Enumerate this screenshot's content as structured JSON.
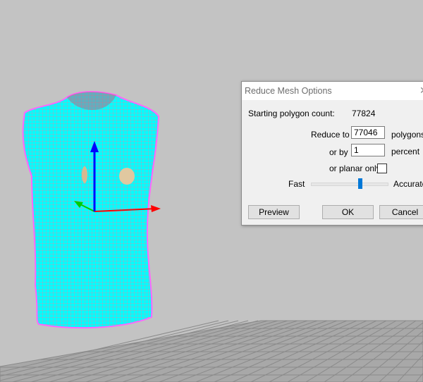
{
  "dialog": {
    "title": "Reduce Mesh Options",
    "close_icon": "close-icon",
    "starting_label": "Starting polygon count:",
    "starting_value": "77824",
    "reduce_to_label": "Reduce to",
    "reduce_to_value": "77046",
    "polygons_label": "polygons",
    "or_by_label": "or by",
    "or_by_value": "1",
    "percent_label": "percent",
    "planar_label": "or planar only",
    "planar_checked": false,
    "fast_label": "Fast",
    "accurate_label": "Accurate",
    "slider_value": 0.65,
    "preview_label": "Preview",
    "ok_label": "OK",
    "cancel_label": "Cancel"
  },
  "colors": {
    "mesh": "#00ffff",
    "wire": "#ff5a7a",
    "axis_x": "#ff0000",
    "axis_y": "#00cc00",
    "axis_z": "#0000ff",
    "accent": "#0078d7"
  }
}
